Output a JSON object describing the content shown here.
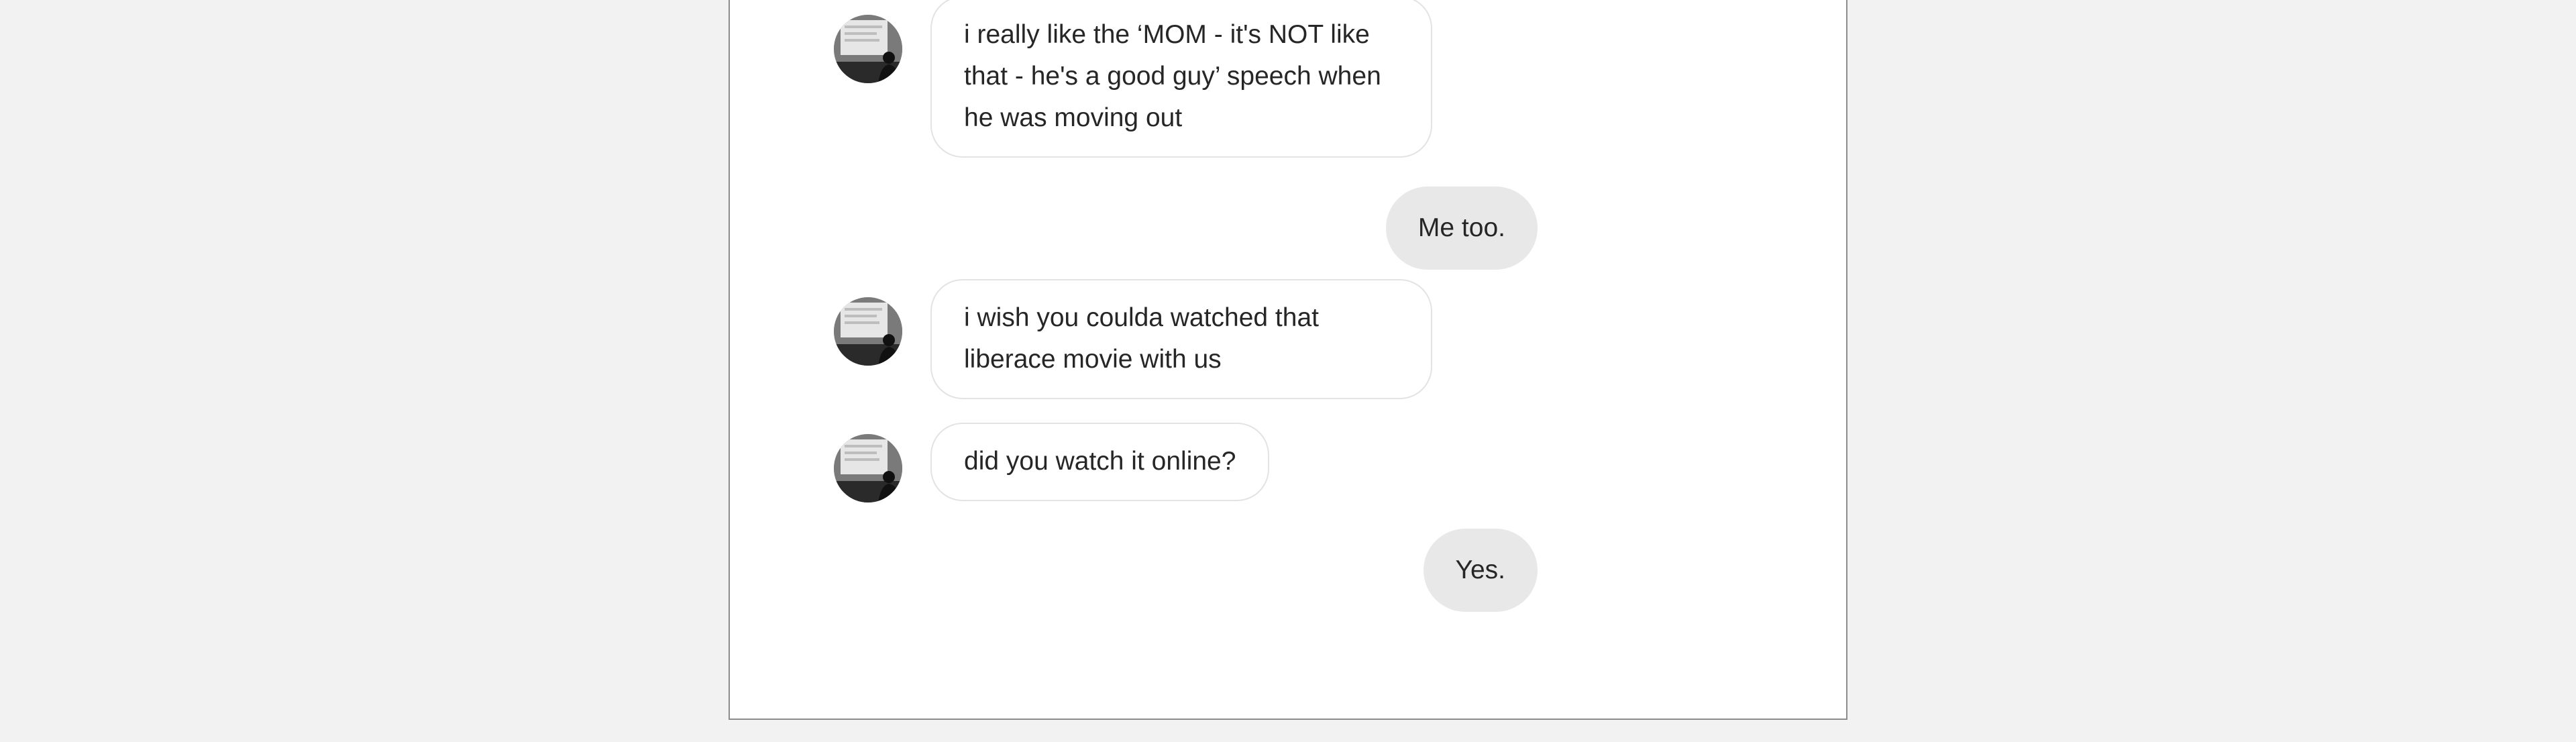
{
  "conversation": {
    "messages": [
      {
        "direction": "incoming",
        "text": "i really like the ‘MOM - it's NOT like that - he's a good guy’ speech when he was moving out"
      },
      {
        "direction": "outgoing",
        "text": "Me too."
      },
      {
        "direction": "incoming",
        "text": "i wish you coulda watched that liberace movie with us"
      },
      {
        "direction": "incoming",
        "text": "did you watch it online?"
      },
      {
        "direction": "outgoing",
        "text": "Yes."
      }
    ]
  },
  "icons": {
    "contact_avatar": "contact-avatar-icon"
  },
  "colors": {
    "page_background": "#f2f2f2",
    "panel_background": "#ffffff",
    "incoming_bubble": "#ffffff",
    "incoming_border": "#e3e3e3",
    "outgoing_bubble": "#e8e8e8",
    "text": "#262626"
  }
}
